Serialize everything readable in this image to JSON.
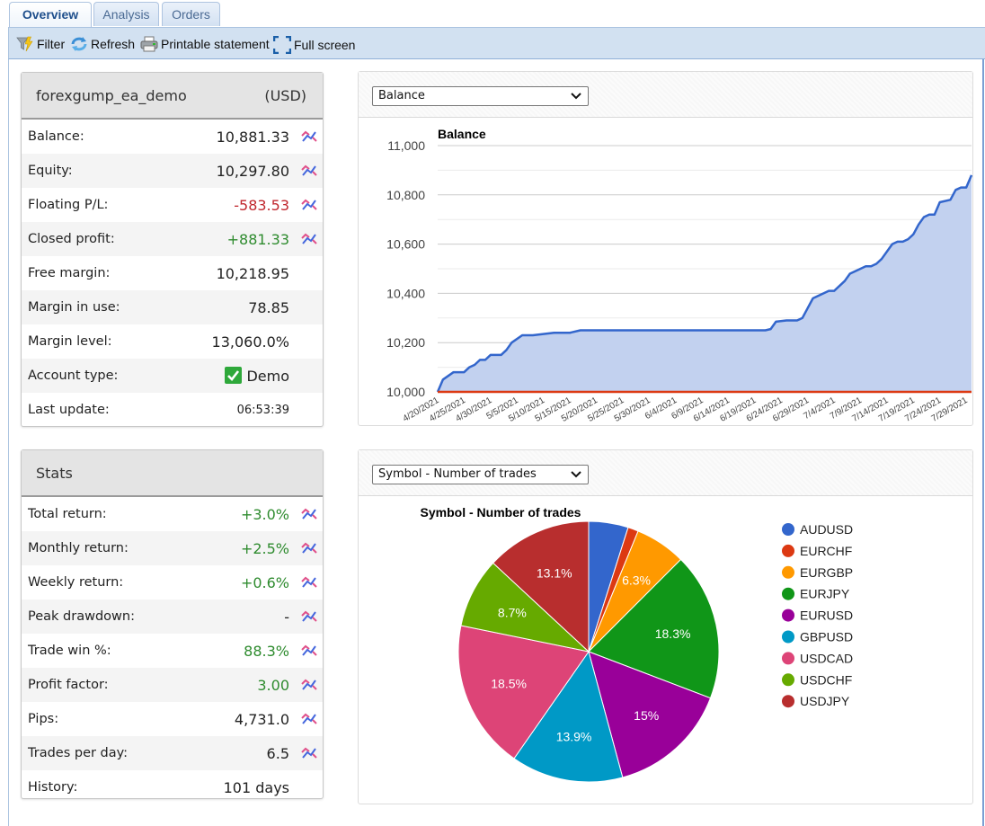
{
  "tabs": [
    {
      "label": "Overview",
      "active": true
    },
    {
      "label": "Analysis",
      "active": false
    },
    {
      "label": "Orders",
      "active": false
    }
  ],
  "toolbar": {
    "filter": {
      "label": "Filter",
      "icon": "filter-icon"
    },
    "refresh": {
      "label": "Refresh",
      "icon": "refresh-icon"
    },
    "print": {
      "label": "Printable statement",
      "icon": "printer-icon"
    },
    "fullscreen": {
      "label": "Full screen",
      "icon": "fullscreen-icon"
    }
  },
  "account": {
    "name": "forexgump_ea_demo",
    "currency": "(USD)",
    "rows": [
      {
        "label": "Balance:",
        "value": "10,881.33",
        "tone": "",
        "chart_icon": true
      },
      {
        "label": "Equity:",
        "value": "10,297.80",
        "tone": "",
        "chart_icon": true
      },
      {
        "label": "Floating P/L:",
        "value": "-583.53",
        "tone": "red",
        "chart_icon": true
      },
      {
        "label": "Closed profit:",
        "value": "+881.33",
        "tone": "green",
        "chart_icon": true
      },
      {
        "label": "Free margin:",
        "value": "10,218.95",
        "tone": "",
        "chart_icon": false
      },
      {
        "label": "Margin in use:",
        "value": "78.85",
        "tone": "",
        "chart_icon": false
      },
      {
        "label": "Margin level:",
        "value": "13,060.0%",
        "tone": "",
        "chart_icon": false
      },
      {
        "label": "Account type:",
        "value": "Demo",
        "tone": "",
        "chart_icon": false,
        "check": true
      },
      {
        "label": "Last update:",
        "value": "06:53:39",
        "tone": "",
        "chart_icon": false,
        "small": true
      }
    ]
  },
  "stats": {
    "title": "Stats",
    "rows": [
      {
        "label": "Total return:",
        "value": "+3.0%",
        "tone": "green",
        "chart_icon": true
      },
      {
        "label": "Monthly return:",
        "value": "+2.5%",
        "tone": "green",
        "chart_icon": true
      },
      {
        "label": "Weekly return:",
        "value": "+0.6%",
        "tone": "green",
        "chart_icon": true
      },
      {
        "label": "Peak drawdown:",
        "value": "-",
        "tone": "",
        "chart_icon": true
      },
      {
        "label": "Trade win %:",
        "value": "88.3%",
        "tone": "green",
        "chart_icon": true
      },
      {
        "label": "Profit factor:",
        "value": "3.00",
        "tone": "green",
        "chart_icon": true
      },
      {
        "label": "Pips:",
        "value": "4,731.0",
        "tone": "",
        "chart_icon": true
      },
      {
        "label": "Trades per day:",
        "value": "6.5",
        "tone": "",
        "chart_icon": true
      },
      {
        "label": "History:",
        "value": "101 days",
        "tone": "",
        "chart_icon": false
      }
    ]
  },
  "balance_panel": {
    "select_value": "Balance"
  },
  "symbol_panel": {
    "select_value": "Symbol - Number of trades"
  },
  "chart_data": [
    {
      "type": "area",
      "title": "Balance",
      "xlabel": "",
      "ylabel": "",
      "ylim": [
        10000,
        11000
      ],
      "yticks": [
        "10,000",
        "10,200",
        "10,400",
        "10,600",
        "10,800",
        "11,000"
      ],
      "ytick_values": [
        10000,
        10200,
        10400,
        10600,
        10800,
        11000
      ],
      "xticks": [
        "4/20/2021",
        "4/25/2021",
        "4/30/2021",
        "5/5/2021",
        "5/10/2021",
        "5/15/2021",
        "5/20/2021",
        "5/25/2021",
        "5/30/2021",
        "6/4/2021",
        "6/9/2021",
        "6/14/2021",
        "6/19/2021",
        "6/24/2021",
        "6/29/2021",
        "7/4/2021",
        "7/9/2021",
        "7/14/2021",
        "7/19/2021",
        "7/24/2021",
        "7/29/2021"
      ],
      "grid": true,
      "legend": "none",
      "day_range": [
        0,
        101
      ],
      "series": [
        {
          "name": "Balance",
          "color": "#3366cc",
          "x_days": [
            0,
            1,
            3,
            5,
            6,
            7,
            8,
            9,
            10,
            11,
            12,
            13,
            14,
            16,
            17,
            18,
            20,
            22,
            24,
            25,
            27,
            29,
            30,
            32,
            34,
            35,
            62,
            63,
            64,
            66,
            67,
            68,
            69,
            70,
            71,
            73,
            74,
            75,
            76,
            77,
            78,
            79,
            81,
            82,
            83,
            84,
            86,
            87,
            88,
            89,
            90,
            91,
            92,
            93,
            94,
            95,
            97,
            98,
            99,
            100,
            101
          ],
          "values": [
            10000,
            10050,
            10080,
            10080,
            10100,
            10110,
            10130,
            10130,
            10150,
            10150,
            10150,
            10170,
            10200,
            10230,
            10230,
            10230,
            10235,
            10240,
            10240,
            10240,
            10250,
            10250,
            10250,
            10250,
            10250,
            10250,
            10250,
            10255,
            10285,
            10290,
            10290,
            10290,
            10300,
            10340,
            10380,
            10400,
            10410,
            10410,
            10430,
            10450,
            10480,
            10490,
            10510,
            10510,
            10520,
            10540,
            10600,
            10610,
            10610,
            10620,
            10640,
            10680,
            10710,
            10720,
            10720,
            10770,
            10780,
            10820,
            10830,
            10830,
            10880
          ]
        },
        {
          "name": "Baseline",
          "color": "#dc3912",
          "x_days": [
            0,
            101
          ],
          "values": [
            10000,
            10000
          ]
        }
      ]
    },
    {
      "type": "pie",
      "title": "Symbol - Number of trades",
      "legend": "right",
      "categories": [
        "AUDUSD",
        "EURCHF",
        "EURGBP",
        "EURJPY",
        "EURUSD",
        "GBPUSD",
        "USDCAD",
        "USDCHF",
        "USDJPY"
      ],
      "values": [
        4.9,
        1.3,
        6.3,
        18.3,
        15.0,
        13.9,
        18.5,
        8.7,
        13.1
      ],
      "labels": [
        "",
        "",
        "6.3%",
        "18.3%",
        "15%",
        "13.9%",
        "18.5%",
        "8.7%",
        "13.1%"
      ],
      "colors": [
        "#3366cc",
        "#dc3912",
        "#ff9900",
        "#109618",
        "#990099",
        "#0099c6",
        "#dd4477",
        "#66aa00",
        "#b82e2e"
      ]
    }
  ]
}
